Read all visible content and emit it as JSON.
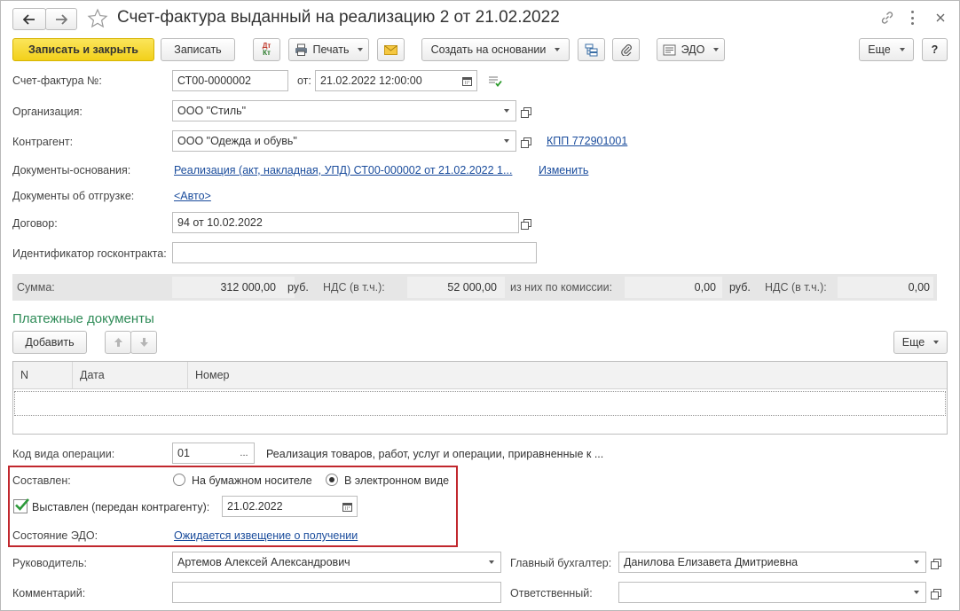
{
  "window": {
    "title": "Счет-фактура выданный на реализацию 2 от 21.02.2022"
  },
  "toolbar": {
    "write_close": "Записать и закрыть",
    "write": "Записать",
    "print": "Печать",
    "create_based": "Создать на основании",
    "edo": "ЭДО",
    "more": "Еще",
    "help": "?"
  },
  "form": {
    "invoice_no_label": "Счет-фактура №:",
    "invoice_no": "СТ00-0000002",
    "date_from_label": "от:",
    "date": "21.02.2022 12:00:00",
    "org_label": "Организация:",
    "org": "ООО \"Стиль\"",
    "counterparty_label": "Контрагент:",
    "counterparty": "ООО \"Одежда и обувь\"",
    "kpp_link": "КПП 772901001",
    "base_docs_label": "Документы-основания:",
    "base_docs_link": "Реализация (акт, накладная, УПД) СТ00-000002 от 21.02.2022 1...",
    "change_link": "Изменить",
    "shipping_docs_label": "Документы об отгрузке:",
    "shipping_docs_link": "<Авто>",
    "contract_label": "Договор:",
    "contract": "94 от 10.02.2022",
    "gov_contract_label": "Идентификатор госконтракта:",
    "gov_contract": ""
  },
  "sums": {
    "sum_label": "Сумма:",
    "sum": "312 000,00",
    "rub1": "руб.",
    "vat_label": "НДС (в т.ч.):",
    "vat": "52 000,00",
    "commission_label": "из них по комиссии:",
    "commission": "0,00",
    "rub2": "руб.",
    "vat2_label": "НДС (в т.ч.):",
    "vat2": "0,00"
  },
  "payments": {
    "title": "Платежные документы",
    "add": "Добавить",
    "more": "Еще",
    "columns": [
      "N",
      "Дата",
      "Номер"
    ]
  },
  "operation": {
    "label": "Код вида операции:",
    "code": "01",
    "browse": "...",
    "description": "Реализация товаров, работ, услуг и операции, приравненные к ..."
  },
  "compiled": {
    "label": "Составлен:",
    "paper": "На бумажном носителе",
    "electronic": "В электронном виде",
    "selected": "electronic"
  },
  "issued": {
    "label": "Выставлен (передан контрагенту):",
    "checked": true,
    "date": "21.02.2022"
  },
  "edo_state": {
    "label": "Состояние ЭДО:",
    "link": "Ожидается извещение о получении"
  },
  "signers": {
    "head_label": "Руководитель:",
    "head": "Артемов Алексей Александрович",
    "accountant_label": "Главный бухгалтер:",
    "accountant": "Данилова Елизавета Дмитриевна",
    "comment_label": "Комментарий:",
    "comment": "",
    "responsible_label": "Ответственный:",
    "responsible": ""
  },
  "colors": {
    "accent_yellow": "#f6d92c",
    "highlight_red": "#c1272d",
    "link_blue": "#1a4c9c",
    "section_green": "#2e8b57"
  }
}
